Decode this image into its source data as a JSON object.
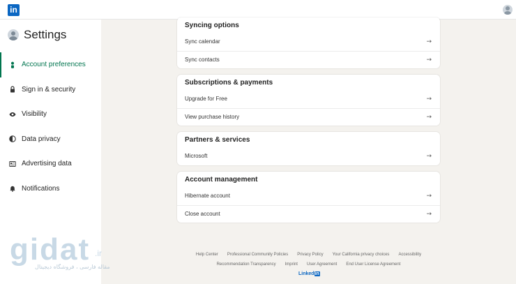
{
  "brand": {
    "logo_text": "in",
    "color": "#0a66c2"
  },
  "accent": "#01754f",
  "sidebar": {
    "title": "Settings",
    "items": [
      {
        "label": "Account preferences",
        "icon": "person-icon",
        "active": true
      },
      {
        "label": "Sign in & security",
        "icon": "lock-icon",
        "active": false
      },
      {
        "label": "Visibility",
        "icon": "eye-icon",
        "active": false
      },
      {
        "label": "Data privacy",
        "icon": "shield-icon",
        "active": false
      },
      {
        "label": "Advertising data",
        "icon": "newspaper-icon",
        "active": false
      },
      {
        "label": "Notifications",
        "icon": "bell-icon",
        "active": false
      }
    ]
  },
  "sections": [
    {
      "title": "Syncing options",
      "rows": [
        "Sync calendar",
        "Sync contacts"
      ]
    },
    {
      "title": "Subscriptions & payments",
      "rows": [
        "Upgrade for Free",
        "View purchase history"
      ]
    },
    {
      "title": "Partners & services",
      "rows": [
        "Microsoft"
      ]
    },
    {
      "title": "Account management",
      "rows": [
        "Hibernate account",
        "Close account"
      ]
    }
  ],
  "row_arrow": "→",
  "footer": {
    "line1": [
      "Help Center",
      "Professional Community Policies",
      "Privacy Policy",
      "Your California privacy choices",
      "Accessibility"
    ],
    "line2": [
      "Recommendation Transparency",
      "Imprint",
      "User Agreement",
      "End User License Agreement"
    ],
    "brand_text": "Linked",
    "brand_box": "in"
  },
  "watermark": {
    "big": "gidat",
    "suffix": ".ir",
    "tagline": "مقاله فارسی ، فروشگاه دیجیتال"
  }
}
